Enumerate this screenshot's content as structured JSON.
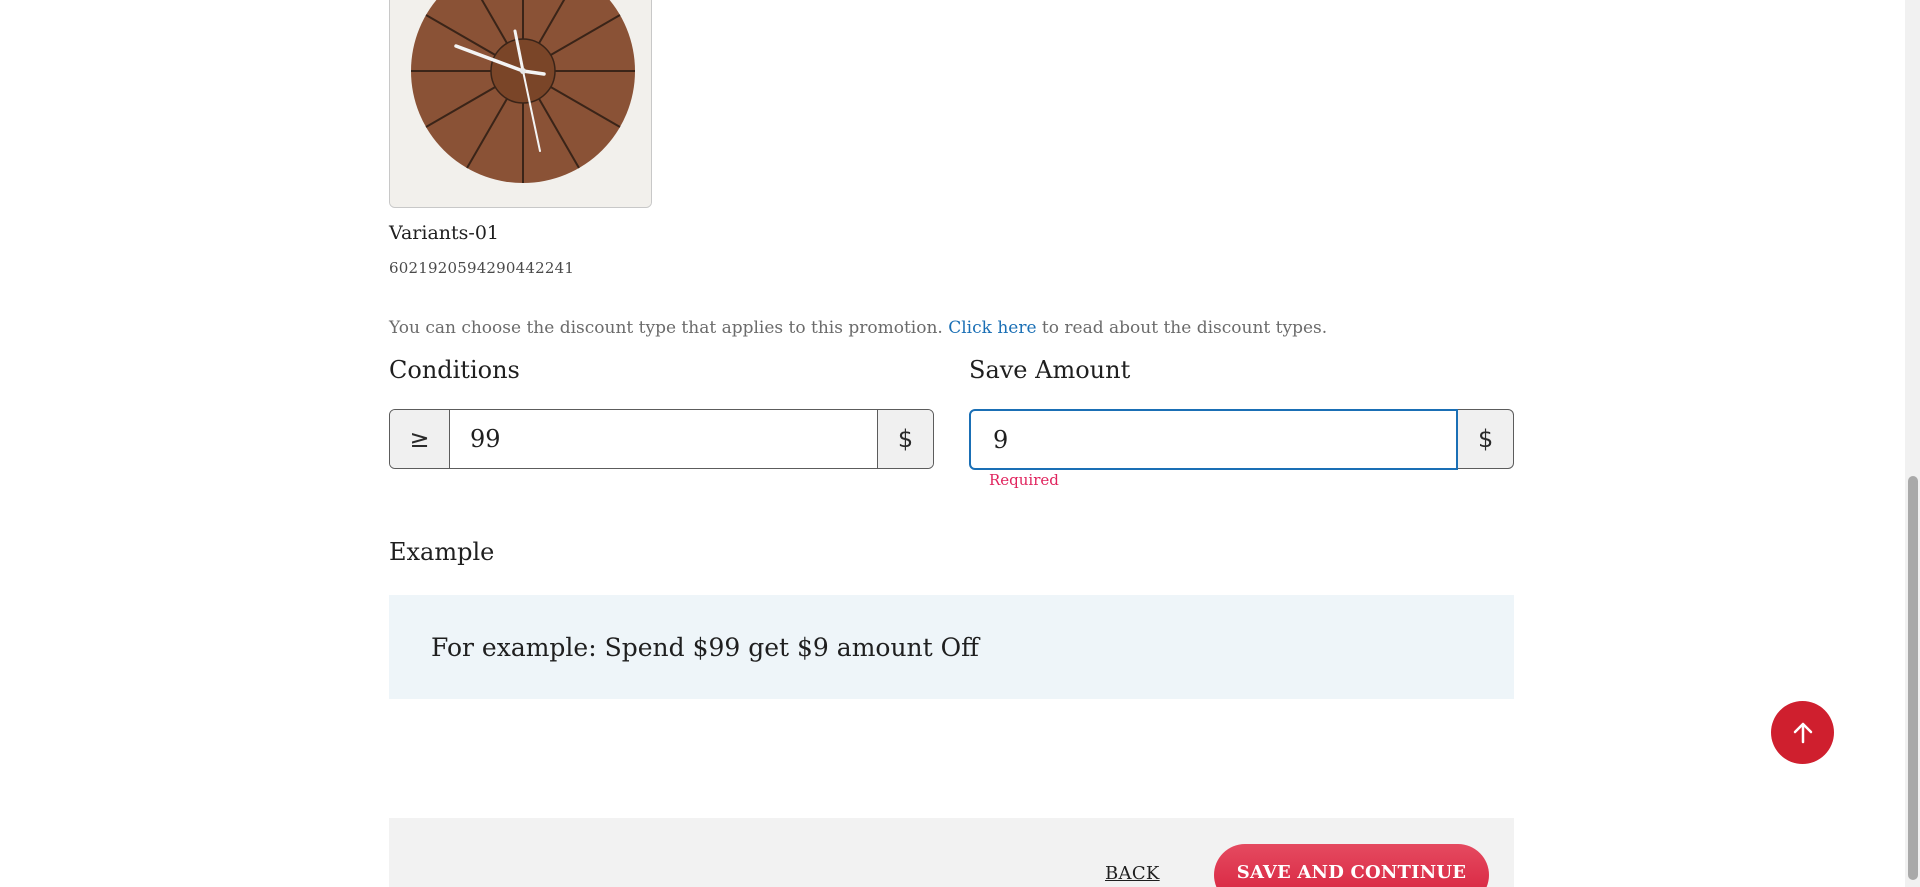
{
  "product": {
    "image": "wall-clock-product-photo",
    "variant_name": "Variants-01",
    "variant_id": "6021920594290442241"
  },
  "info": {
    "text_before": "You can choose the discount type that applies to this promotion. ",
    "link_text": "Click here",
    "text_after": " to read about the discount types."
  },
  "conditions": {
    "label": "Conditions",
    "operator": "≥",
    "value": "99",
    "unit": "$"
  },
  "save_amount": {
    "label": "Save Amount",
    "value": "9",
    "unit": "$",
    "error": "Required"
  },
  "example": {
    "label": "Example",
    "text": "For example: Spend $99 get $9 amount Off"
  },
  "footer": {
    "back_label": "BACK",
    "save_label": "SAVE AND CONTINUE"
  },
  "scroll_top": {
    "icon": "arrow-up-icon"
  },
  "colors": {
    "primary_red": "#cf1f2e",
    "link_blue": "#1a6fb5",
    "error_pink": "#e0245e",
    "example_bg": "#eef5f9"
  }
}
